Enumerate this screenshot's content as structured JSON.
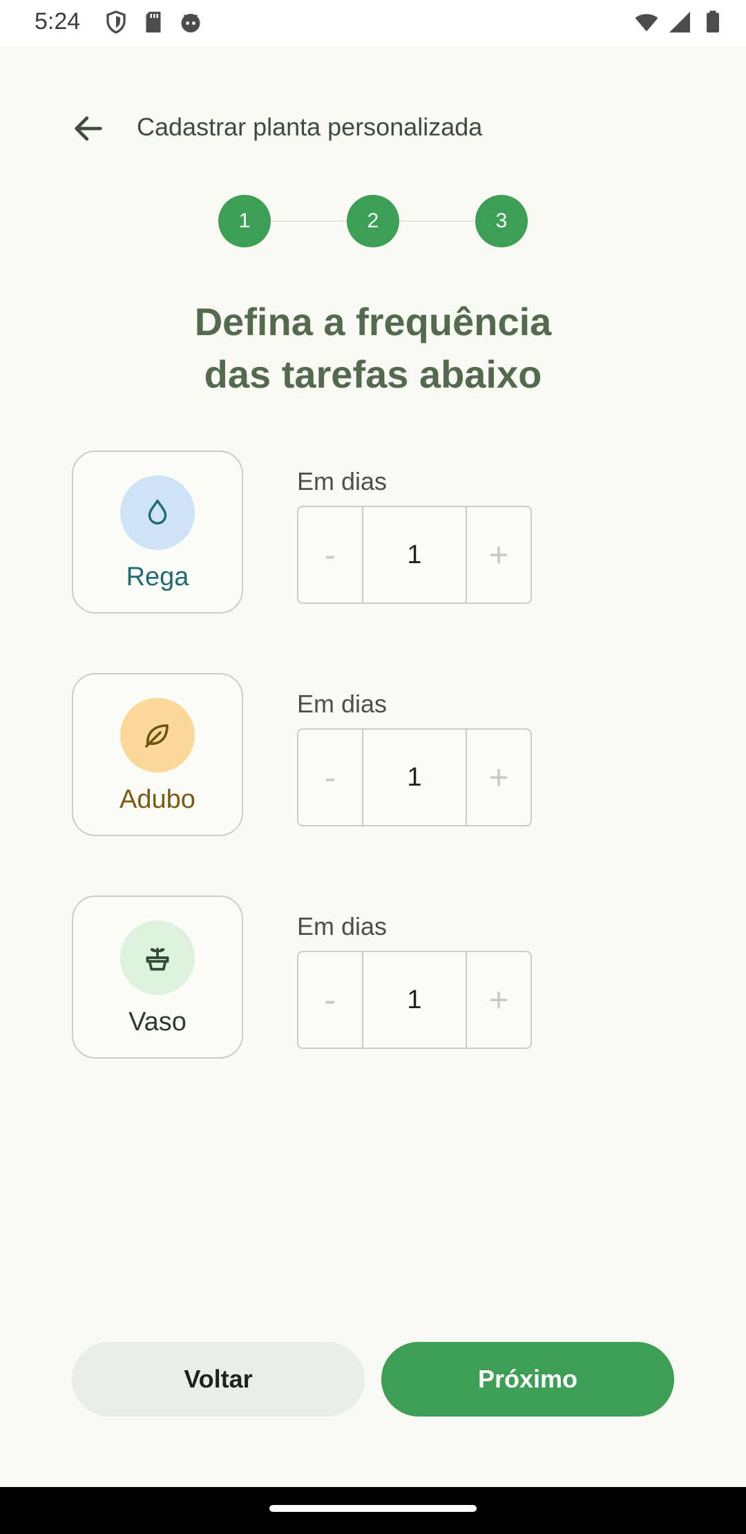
{
  "status_bar": {
    "time": "5:24",
    "left_icons": [
      "shield-icon",
      "sd-card-icon",
      "android-face-icon"
    ],
    "right_icons": [
      "wifi-icon",
      "signal-icon",
      "battery-icon"
    ]
  },
  "header": {
    "back_icon": "arrow-back-icon",
    "title": "Cadastrar planta personalizada"
  },
  "stepper": {
    "steps": [
      "1",
      "2",
      "3"
    ],
    "active_color": "#3d9e55"
  },
  "heading": {
    "line1": "Defina a frequência",
    "line2": "das tarefas abaixo"
  },
  "tasks": [
    {
      "label": "Rega",
      "icon": "water-drop-icon",
      "icon_bg": "#cfe3f6",
      "label_color": "#1f6b73",
      "freq_label": "Em dias",
      "minus": "-",
      "value": "1",
      "plus": "+"
    },
    {
      "label": "Adubo",
      "icon": "leaf-icon",
      "icon_bg": "#fcd99a",
      "label_color": "#7a5a10",
      "freq_label": "Em dias",
      "minus": "-",
      "value": "1",
      "plus": "+"
    },
    {
      "label": "Vaso",
      "icon": "potted-plant-icon",
      "icon_bg": "#dff1df",
      "label_color": "#2e3a2e",
      "freq_label": "Em dias",
      "minus": "-",
      "value": "1",
      "plus": "+"
    }
  ],
  "buttons": {
    "back": "Voltar",
    "next": "Próximo"
  }
}
